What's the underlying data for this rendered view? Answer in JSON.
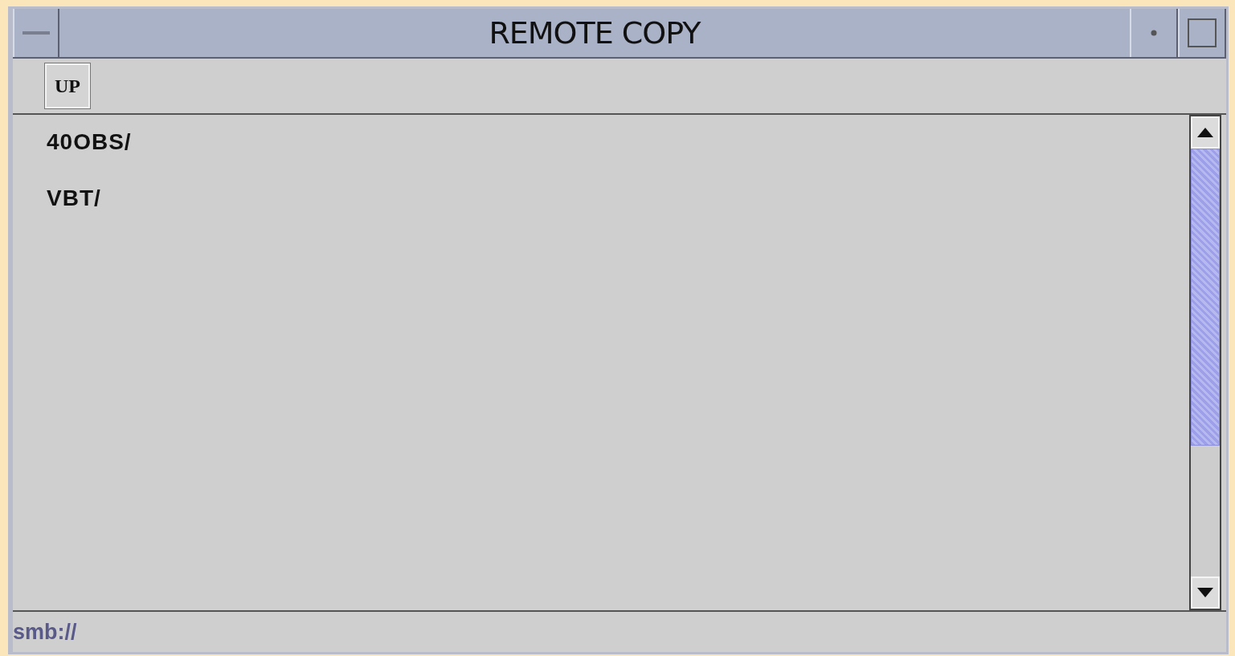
{
  "window": {
    "title": "REMOTE COPY"
  },
  "toolbar": {
    "buttons": [
      "UP"
    ]
  },
  "file_list": {
    "items": [
      {
        "name": "40OBS/"
      },
      {
        "name": "VBT/"
      }
    ]
  },
  "status_bar": {
    "path": "smb://"
  }
}
